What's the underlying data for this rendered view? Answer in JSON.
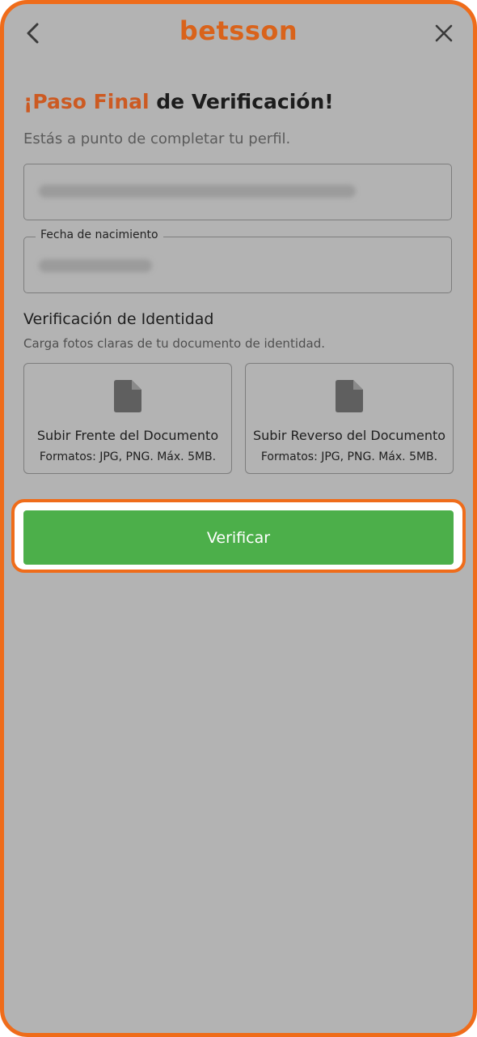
{
  "header": {
    "logo_text": "betsson",
    "back_icon": "chevron-left-icon",
    "close_icon": "close-icon"
  },
  "main": {
    "title_accent": "¡Paso Final",
    "title_rest": " de Verificación!",
    "subtitle": "Estás a punto de completar tu perfil.",
    "fields": [
      {
        "label": "",
        "value": ""
      },
      {
        "label": "Fecha de nacimiento",
        "value": ""
      }
    ],
    "identity": {
      "title": "Verificación de Identidad",
      "subtitle": "Carga fotos claras de tu documento de identidad."
    },
    "uploads": [
      {
        "title": "Subir Frente del Documento",
        "formats": "Formatos: JPG, PNG. Máx. 5MB.",
        "icon": "document-icon"
      },
      {
        "title": "Subir Reverso del Documento",
        "formats": "Formatos: JPG, PNG. Máx. 5MB.",
        "icon": "document-icon"
      }
    ],
    "verify_button": "Verificar"
  },
  "colors": {
    "brand": "#d9631b",
    "accent_border": "#ef6c1a",
    "button_green": "#4caf4a",
    "overlay_gray": "#b3b3b3"
  }
}
